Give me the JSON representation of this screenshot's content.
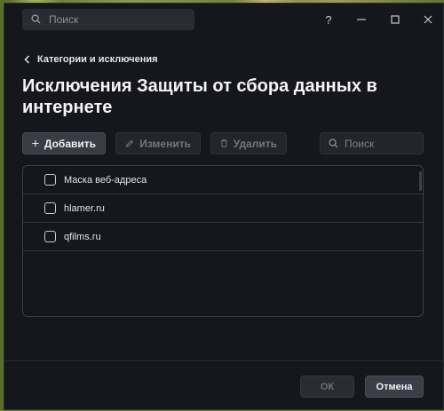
{
  "titlebar": {
    "search_placeholder": "Поиск",
    "help_label": "?"
  },
  "breadcrumb": {
    "label": "Категории и исключения"
  },
  "page": {
    "title": "Исключения Защиты от сбора данных в интернете"
  },
  "toolbar": {
    "add_label": "Добавить",
    "edit_label": "Изменить",
    "delete_label": "Удалить",
    "search_placeholder": "Поиск"
  },
  "list": {
    "header": "Маска веб-адреса",
    "items": [
      {
        "label": "hlamer.ru"
      },
      {
        "label": "qfilms.ru"
      }
    ]
  },
  "footer": {
    "ok_label": "ОК",
    "cancel_label": "Отмена"
  },
  "colors": {
    "background": "#16171d",
    "button_active": "#3a3c45",
    "button_disabled": "#23252c",
    "text_primary": "#f0f0f2",
    "text_disabled": "#73767f"
  },
  "icons": [
    "search-icon",
    "help-icon",
    "minimize-icon",
    "maximize-icon",
    "close-icon",
    "chevron-left-icon",
    "plus-icon",
    "pencil-icon",
    "trash-icon"
  ]
}
